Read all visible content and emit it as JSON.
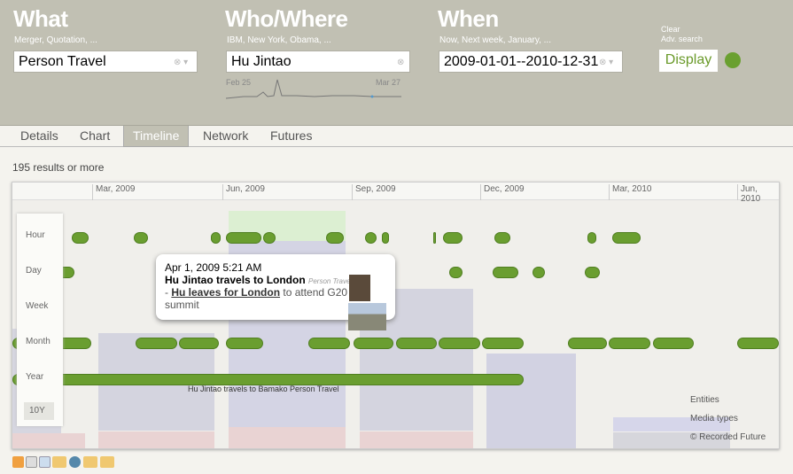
{
  "search": {
    "what": {
      "title": "What",
      "hint": "Merger, Quotation, ...",
      "value": "Person Travel"
    },
    "who": {
      "title": "Who/Where",
      "hint": "IBM, New York, Obama, ...",
      "value": "Hu Jintao",
      "spark_start": "Feb 25",
      "spark_end": "Mar 27"
    },
    "when": {
      "title": "When",
      "hint": "Now, Next week, January, ...",
      "value": "2009-01-01--2010-12-31"
    },
    "clear": "Clear",
    "adv": "Adv. search",
    "display": "Display"
  },
  "tabs": [
    "Details",
    "Chart",
    "Timeline",
    "Network",
    "Futures"
  ],
  "active_tab": "Timeline",
  "results": "195 results or more",
  "timeline": {
    "ticks": [
      "Mar, 2009",
      "Jun, 2009",
      "Sep, 2009",
      "Dec, 2009",
      "Mar, 2010",
      "Jun, 2010"
    ],
    "zoom_levels": [
      "Hour",
      "Day",
      "Week",
      "Month",
      "Year",
      "10Y"
    ],
    "year_label": "Hu Jintao travels to Bamako Person Travel",
    "legend": [
      "Entities",
      "Media types",
      "© Recorded Future"
    ],
    "tooltip": {
      "date": "Apr 1, 2009 5:21 AM",
      "title": "Hu Jintao travels to London",
      "type": "Person Travel",
      "dash": "- ",
      "link": "Hu leaves for London",
      "rest": " to attend G20 summit"
    }
  },
  "colors": {
    "accent": "#6a9e30",
    "header": "#c1c0b3"
  },
  "footer_icons": [
    "rss-icon",
    "calendar-icon",
    "excel-icon",
    "xml-icon",
    "globe-icon",
    "widget-icon",
    "list-icon"
  ]
}
